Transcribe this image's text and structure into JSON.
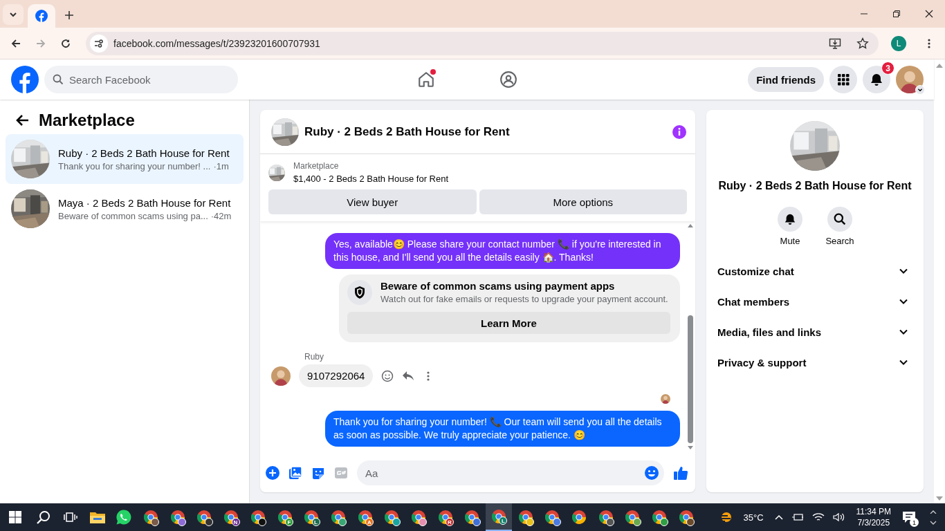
{
  "browser": {
    "tabs": [
      {
        "kind": "facebook",
        "selected": true
      }
    ],
    "address": "facebook.com/messages/t/23923201600707931",
    "profile_initial": "L"
  },
  "header": {
    "search": {
      "placeholder": "Search Facebook"
    },
    "nav": [
      {
        "kind": "home",
        "dot": true
      },
      {
        "kind": "groups",
        "dot": false
      }
    ],
    "find_friends": "Find friends",
    "notifications_badge": "3"
  },
  "sidebar": {
    "title": "Marketplace",
    "conversations": [
      {
        "name": "Ruby · 2 Beds 2 Bath House for Rent",
        "preview": "Thank you for sharing your number! ...",
        "time": "·1m",
        "selected": true
      },
      {
        "name": "Maya · 2 Beds 2 Bath House for Rent",
        "preview": "Beware of common scams using pa...",
        "time": "·42m",
        "selected": false
      }
    ]
  },
  "chat": {
    "title": "Ruby · 2 Beds 2 Bath House for Rent",
    "listing": {
      "label": "Marketplace",
      "title": "$1,400 - 2 Beds 2 Bath House for Rent"
    },
    "buttons": [
      "View buyer",
      "More options"
    ],
    "messages": [
      {
        "kind": "outgoing",
        "color": "#7431f9",
        "text": "Yes, available😊 Please share your contact number 📞 if you're interested in this house, and I'll send you all the details easily 🏠. Thanks!"
      },
      {
        "kind": "notice",
        "title": "Beware of common scams using payment apps",
        "body": "Watch out for fake emails or requests to upgrade your payment account.",
        "button": "Learn More"
      },
      {
        "kind": "incoming",
        "sender": "Ruby",
        "text": "9107292064"
      },
      {
        "kind": "seen"
      },
      {
        "kind": "outgoing",
        "color": "#0a66ff",
        "text": "Thank you for sharing your number! 📞 Our team will send you all the details as soon as possible. We truly appreciate your patience. 😊"
      }
    ],
    "composer": {
      "placeholder": "Aa"
    }
  },
  "details": {
    "title": "Ruby · 2 Beds 2 Bath House for Rent",
    "actions": [
      {
        "kind": "bell",
        "label": "Mute"
      },
      {
        "kind": "search",
        "label": "Search"
      }
    ],
    "sections": [
      {
        "label": "Customize chat",
        "expanded": false
      },
      {
        "label": "Chat members",
        "expanded": false
      },
      {
        "label": "Media, files and links",
        "expanded": false
      },
      {
        "label": "Privacy & support",
        "expanded": false
      }
    ]
  },
  "taskbar": {
    "apps": [
      {
        "kind": "windows",
        "selected": false
      },
      {
        "kind": "search",
        "selected": false
      },
      {
        "kind": "taskview",
        "selected": false
      },
      {
        "kind": "explorer",
        "selected": false
      },
      {
        "kind": "whatsapp",
        "selected": false
      },
      {
        "kind": "chrome",
        "color": "#7a5a4a",
        "selected": false
      },
      {
        "kind": "chrome",
        "color": "#8e6bd8",
        "selected": false
      },
      {
        "kind": "chrome",
        "color": "#333333",
        "selected": false
      },
      {
        "kind": "chrome",
        "color": "#6a2c91",
        "badge": "N",
        "selected": false
      },
      {
        "kind": "chrome",
        "color": "#111111",
        "selected": false
      },
      {
        "kind": "chrome",
        "color": "#2e9d3a",
        "badge": "F",
        "selected": false
      },
      {
        "kind": "chrome",
        "color": "#1d6b4f",
        "badge": "L",
        "selected": false
      },
      {
        "kind": "chrome",
        "color": "#3aa676",
        "selected": false
      },
      {
        "kind": "chrome",
        "color": "#e8711a",
        "badge": "A",
        "selected": false
      },
      {
        "kind": "chrome",
        "color": "#1aa3a3",
        "selected": false
      },
      {
        "kind": "chrome",
        "color": "#e58fb0",
        "selected": false
      },
      {
        "kind": "chrome",
        "color": "#c62828",
        "badge": "R",
        "selected": false
      },
      {
        "kind": "chrome",
        "color": "#3f6fd8",
        "selected": false
      },
      {
        "kind": "chrome",
        "color": "#14806b",
        "badge": "L",
        "selected": true
      },
      {
        "kind": "chrome",
        "color": "#e8c21a",
        "selected": false
      },
      {
        "kind": "chrome",
        "color": "#4a7be0",
        "selected": false
      },
      {
        "kind": "chrome",
        "selected": false
      },
      {
        "kind": "chrome",
        "color": "#555555",
        "selected": false
      },
      {
        "kind": "chrome",
        "color": "#6aa84f",
        "selected": false
      },
      {
        "kind": "chrome",
        "color": "#2f9e44",
        "selected": false
      },
      {
        "kind": "chrome",
        "color": "#6b4a2a",
        "selected": false
      }
    ],
    "temperature": "35°C",
    "time": "11:34 PM",
    "date": "7/3/2025",
    "notifications": "1"
  }
}
